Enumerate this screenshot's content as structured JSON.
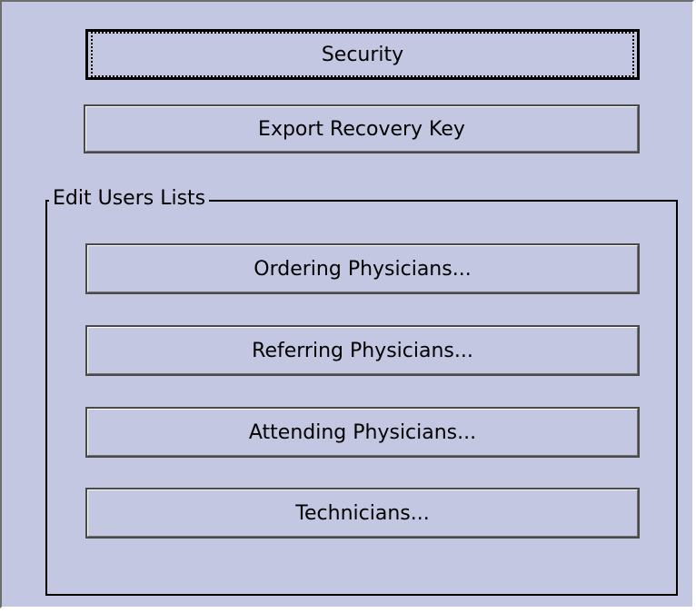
{
  "security_button": {
    "label": "Security"
  },
  "export_recovery_key_button": {
    "label": "Export Recovery Key"
  },
  "edit_users_group": {
    "title": "Edit Users Lists",
    "buttons": [
      {
        "label": "Ordering Physicians..."
      },
      {
        "label": "Referring Physicians..."
      },
      {
        "label": "Attending Physicians..."
      },
      {
        "label": "Technicians..."
      }
    ]
  },
  "colors": {
    "panel_background": "#c3c7e2",
    "button_face": "#c3c7e2",
    "text": "#000000"
  }
}
